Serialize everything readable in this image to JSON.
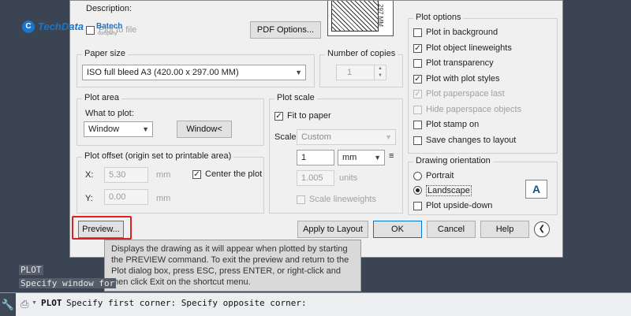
{
  "logo": {
    "brand": "TechData",
    "sub": "Batech",
    "tagline": "company"
  },
  "dialog": {
    "description_label": "Description:",
    "plot_to_file_label": "Plot to file",
    "pdf_options_button": "PDF Options...",
    "preview_size_text": "297 MM",
    "paper_size": {
      "title": "Paper size",
      "value": "ISO full bleed A3 (420.00 x 297.00 MM)"
    },
    "copies": {
      "title": "Number of copies",
      "value": "1"
    },
    "plot_area": {
      "title": "Plot area",
      "what_label": "What to plot:",
      "what_value": "Window",
      "window_button": "Window<"
    },
    "plot_offset": {
      "title": "Plot offset (origin set to printable area)",
      "x_label": "X:",
      "x_value": "5.30",
      "x_unit": "mm",
      "y_label": "Y:",
      "y_value": "0.00",
      "y_unit": "mm",
      "center_label": "Center the plot"
    },
    "plot_scale": {
      "title": "Plot scale",
      "fit_label": "Fit to paper",
      "scale_label": "Scale:",
      "scale_value": "Custom",
      "val1": "1",
      "unit1": "mm",
      "eq": "≡",
      "val2": "1.005",
      "unit2": "units",
      "lineweights_label": "Scale lineweights"
    },
    "plot_options": {
      "title": "Plot options",
      "items": [
        {
          "label": "Plot in background",
          "checked": false,
          "disabled": false
        },
        {
          "label": "Plot object lineweights",
          "checked": true,
          "disabled": false
        },
        {
          "label": "Plot transparency",
          "checked": false,
          "disabled": false
        },
        {
          "label": "Plot with plot styles",
          "checked": true,
          "disabled": false
        },
        {
          "label": "Plot paperspace last",
          "checked": true,
          "disabled": true
        },
        {
          "label": "Hide paperspace objects",
          "checked": false,
          "disabled": true
        },
        {
          "label": "Plot stamp on",
          "checked": false,
          "disabled": false
        },
        {
          "label": "Save changes to layout",
          "checked": false,
          "disabled": false
        }
      ]
    },
    "orientation": {
      "title": "Drawing orientation",
      "portrait": "Portrait",
      "landscape": "Landscape",
      "upside": "Plot upside-down",
      "icon_letter": "A"
    },
    "buttons": {
      "preview": "Preview...",
      "apply": "Apply to Layout",
      "ok": "OK",
      "cancel": "Cancel",
      "help": "Help"
    },
    "tooltip": "Displays the drawing as it will appear when plotted by starting the PREVIEW command. To exit the preview and return to the Plot dialog box, press ESC, press ENTER, or right-click and then click Exit on the shortcut menu."
  },
  "command": {
    "history1": "PLOT",
    "history2": "Specify window for",
    "prefix": "PLOT",
    "line": "Specify first corner: Specify opposite corner:"
  },
  "colors": {
    "highlight": "#e02020",
    "background": "#3b4453"
  }
}
